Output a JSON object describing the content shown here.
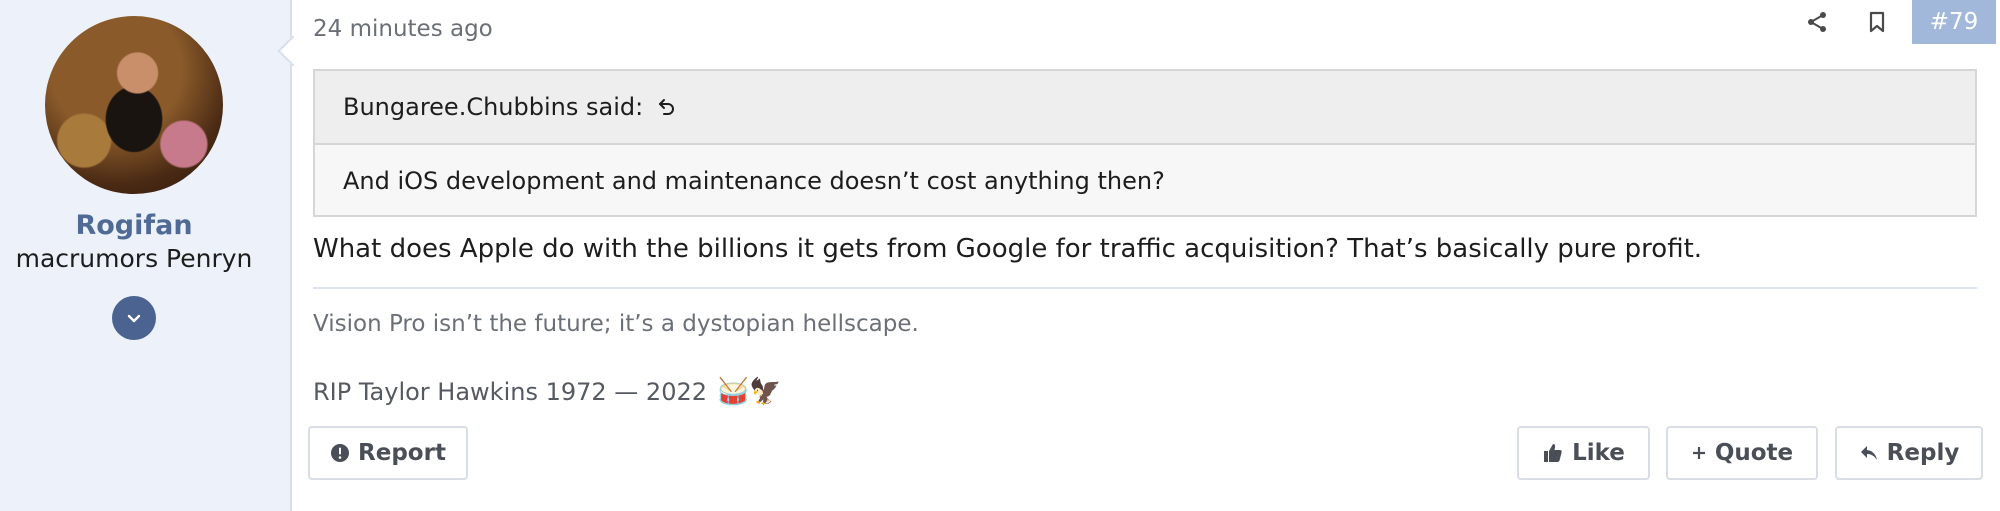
{
  "user": {
    "name": "Rogifan",
    "title": "macrumors Penryn"
  },
  "post": {
    "timestamp": "24 minutes ago",
    "number": "#79",
    "quote": {
      "author": "Bungaree.Chubbins said:",
      "text": "And iOS development and maintenance doesn’t cost anything then?"
    },
    "message": "What does Apple do with the billions it gets from Google for traffic acquisition? That’s basically pure profit.",
    "signature": {
      "line1": "Vision Pro isn’t the future; it’s a dystopian hellscape.",
      "line2": "RIP Taylor Hawkins 1972 — 2022",
      "emojis": "🥁🦅"
    }
  },
  "actions": {
    "report": "Report",
    "like": "Like",
    "quote": "Quote",
    "reply": "Reply"
  },
  "colors": {
    "username": "#4f6a94",
    "post_number_bg": "#a2b8da",
    "sidebar_bg": "#edf2fa"
  },
  "icons": [
    "chevron-down-icon",
    "share-icon",
    "bookmark-icon",
    "reply-arrow-icon",
    "exclamation-circle-icon",
    "thumbs-up-icon",
    "plus-icon",
    "reply-icon"
  ]
}
